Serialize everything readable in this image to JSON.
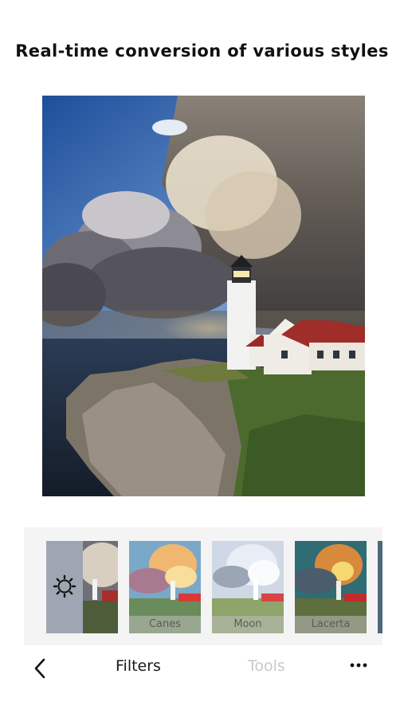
{
  "headline": "Real-time conversion of various styles",
  "photo": {
    "subject": "lighthouse-on-rocky-coast-photo"
  },
  "filters": [
    {
      "id": "adjust",
      "label": "",
      "icon": "brightness-icon"
    },
    {
      "id": "canes",
      "label": "Canes"
    },
    {
      "id": "moon",
      "label": "Moon"
    },
    {
      "id": "lacerta",
      "label": "Lacerta"
    }
  ],
  "bottom_bar": {
    "back_icon": "chevron-left-icon",
    "tab_filters": "Filters",
    "tab_tools": "Tools",
    "more_icon": "ellipsis-icon",
    "active_tab": "Filters"
  },
  "colors": {
    "active_tab": "#1a1a1a",
    "inactive_tab": "#c8c8c8",
    "label_bg": "#bebebe",
    "strip_bg": "#f4f4f4"
  }
}
